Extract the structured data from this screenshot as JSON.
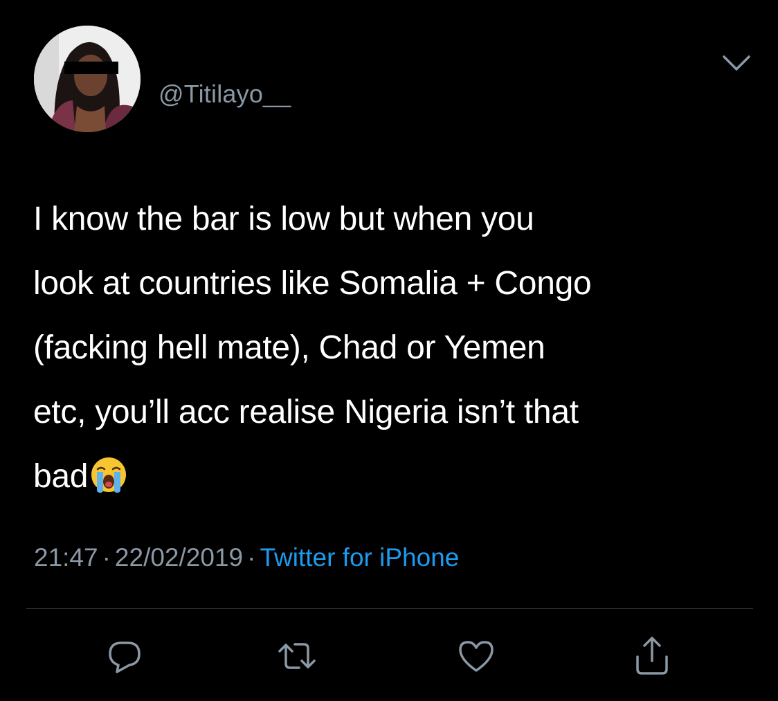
{
  "tweet": {
    "handle": "@Titilayo__",
    "text_lines": [
      "I know the bar is low but when you",
      "look at countries like Somalia + Congo",
      "(facking hell mate), Chad or Yemen",
      "etc, you’ll acc realise Nigeria isn’t that",
      "bad"
    ],
    "emoji": "loudly-crying-face",
    "time": "21:47",
    "separator": "·",
    "date": "22/02/2019",
    "source": "Twitter for iPhone"
  },
  "icons": {
    "menu": "chevron-down-icon",
    "reply": "reply-icon",
    "retweet": "retweet-icon",
    "like": "heart-icon",
    "share": "share-icon"
  },
  "colors": {
    "background": "#000000",
    "text": "#ffffff",
    "secondary": "#8b98a5",
    "link": "#1d9bf0",
    "divider": "#2f3336"
  }
}
